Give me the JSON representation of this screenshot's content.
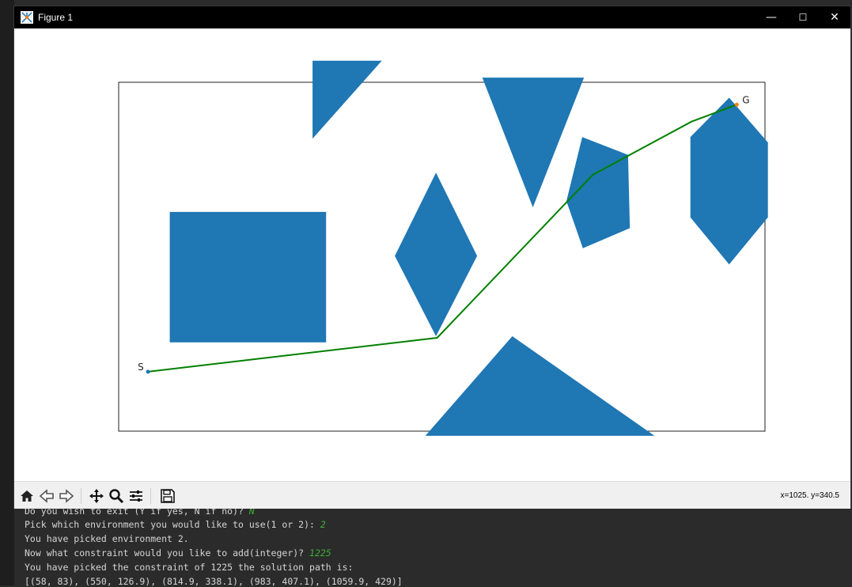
{
  "window": {
    "title": "Figure 1",
    "controls": {
      "minimize": "—",
      "maximize": "☐",
      "close": "✕"
    }
  },
  "toolbar": {
    "buttons": [
      {
        "name": "home-icon",
        "icon": "home"
      },
      {
        "name": "back-icon",
        "icon": "arrow-left"
      },
      {
        "name": "forward-icon",
        "icon": "arrow-right"
      },
      {
        "name": "pan-icon",
        "icon": "move"
      },
      {
        "name": "zoom-icon",
        "icon": "magnifier"
      },
      {
        "name": "configure-subplots-icon",
        "icon": "sliders"
      },
      {
        "name": "save-icon",
        "icon": "floppy-disk"
      }
    ],
    "coordinates": "x=1025. y=340.5"
  },
  "terminal": {
    "lines": [
      {
        "text": "Do you wish to exit (Y if yes, N if no)? ",
        "answer": "N"
      },
      {
        "text": "Pick which environment you would like to use(1 or 2): ",
        "answer": "2"
      },
      {
        "text": "You have picked environment 2.",
        "answer": ""
      },
      {
        "text": "Now what constraint would you like to add(integer)? ",
        "answer": "1225"
      },
      {
        "text": "You have picked the constraint of 1225 the solution path is:",
        "answer": ""
      },
      {
        "text": "[(58, 83), (550, 126.9), (814.9, 338.1), (983, 407.1), (1059.9, 429)]",
        "answer": ""
      }
    ]
  },
  "chart_data": {
    "type": "line",
    "title": "",
    "xlabel": "",
    "ylabel": "",
    "xlim": [
      8,
      1108
    ],
    "ylim": [
      6,
      458
    ],
    "axes_visible": false,
    "grid": false,
    "colors": {
      "obstacle": "#1f77b4",
      "path": "#008000",
      "start": "#1f77b4",
      "goal": "#ff7f0e"
    },
    "obstacles": [
      {
        "shape": "rectangle",
        "points": [
          [
            95,
            121
          ],
          [
            361,
            121
          ],
          [
            361,
            290
          ],
          [
            95,
            290
          ]
        ]
      },
      {
        "shape": "triangle",
        "points": [
          [
            338,
            385
          ],
          [
            338,
            486
          ],
          [
            456,
            486
          ]
        ]
      },
      {
        "shape": "diamond",
        "points": [
          [
            548,
            129
          ],
          [
            618,
            233
          ],
          [
            548,
            341
          ],
          [
            478,
            233
          ]
        ]
      },
      {
        "shape": "inverted-triangle",
        "points": [
          [
            627,
            464
          ],
          [
            800,
            464
          ],
          [
            713,
            296
          ]
        ]
      },
      {
        "shape": "triangle",
        "points": [
          [
            530,
            0
          ],
          [
            920,
            0
          ],
          [
            678,
            129
          ]
        ]
      },
      {
        "shape": "pentagon",
        "points": [
          [
            797,
            387
          ],
          [
            875,
            364
          ],
          [
            878,
            269
          ],
          [
            798,
            243
          ],
          [
            770,
            304
          ]
        ]
      },
      {
        "shape": "hexagon",
        "points": [
          [
            1047,
            438
          ],
          [
            1113,
            380
          ],
          [
            1113,
            283
          ],
          [
            1047,
            222
          ],
          [
            981,
            283
          ],
          [
            981,
            387
          ]
        ]
      }
    ],
    "series": [
      {
        "name": "",
        "x": [
          58,
          550,
          814.9,
          983,
          1059.9
        ],
        "y": [
          83,
          126.9,
          338.1,
          407.1,
          429
        ]
      }
    ],
    "annotations": [
      {
        "text": "S",
        "x": 58,
        "y": 83,
        "role": "start"
      },
      {
        "text": "G",
        "x": 1059.9,
        "y": 429,
        "role": "goal"
      }
    ]
  }
}
